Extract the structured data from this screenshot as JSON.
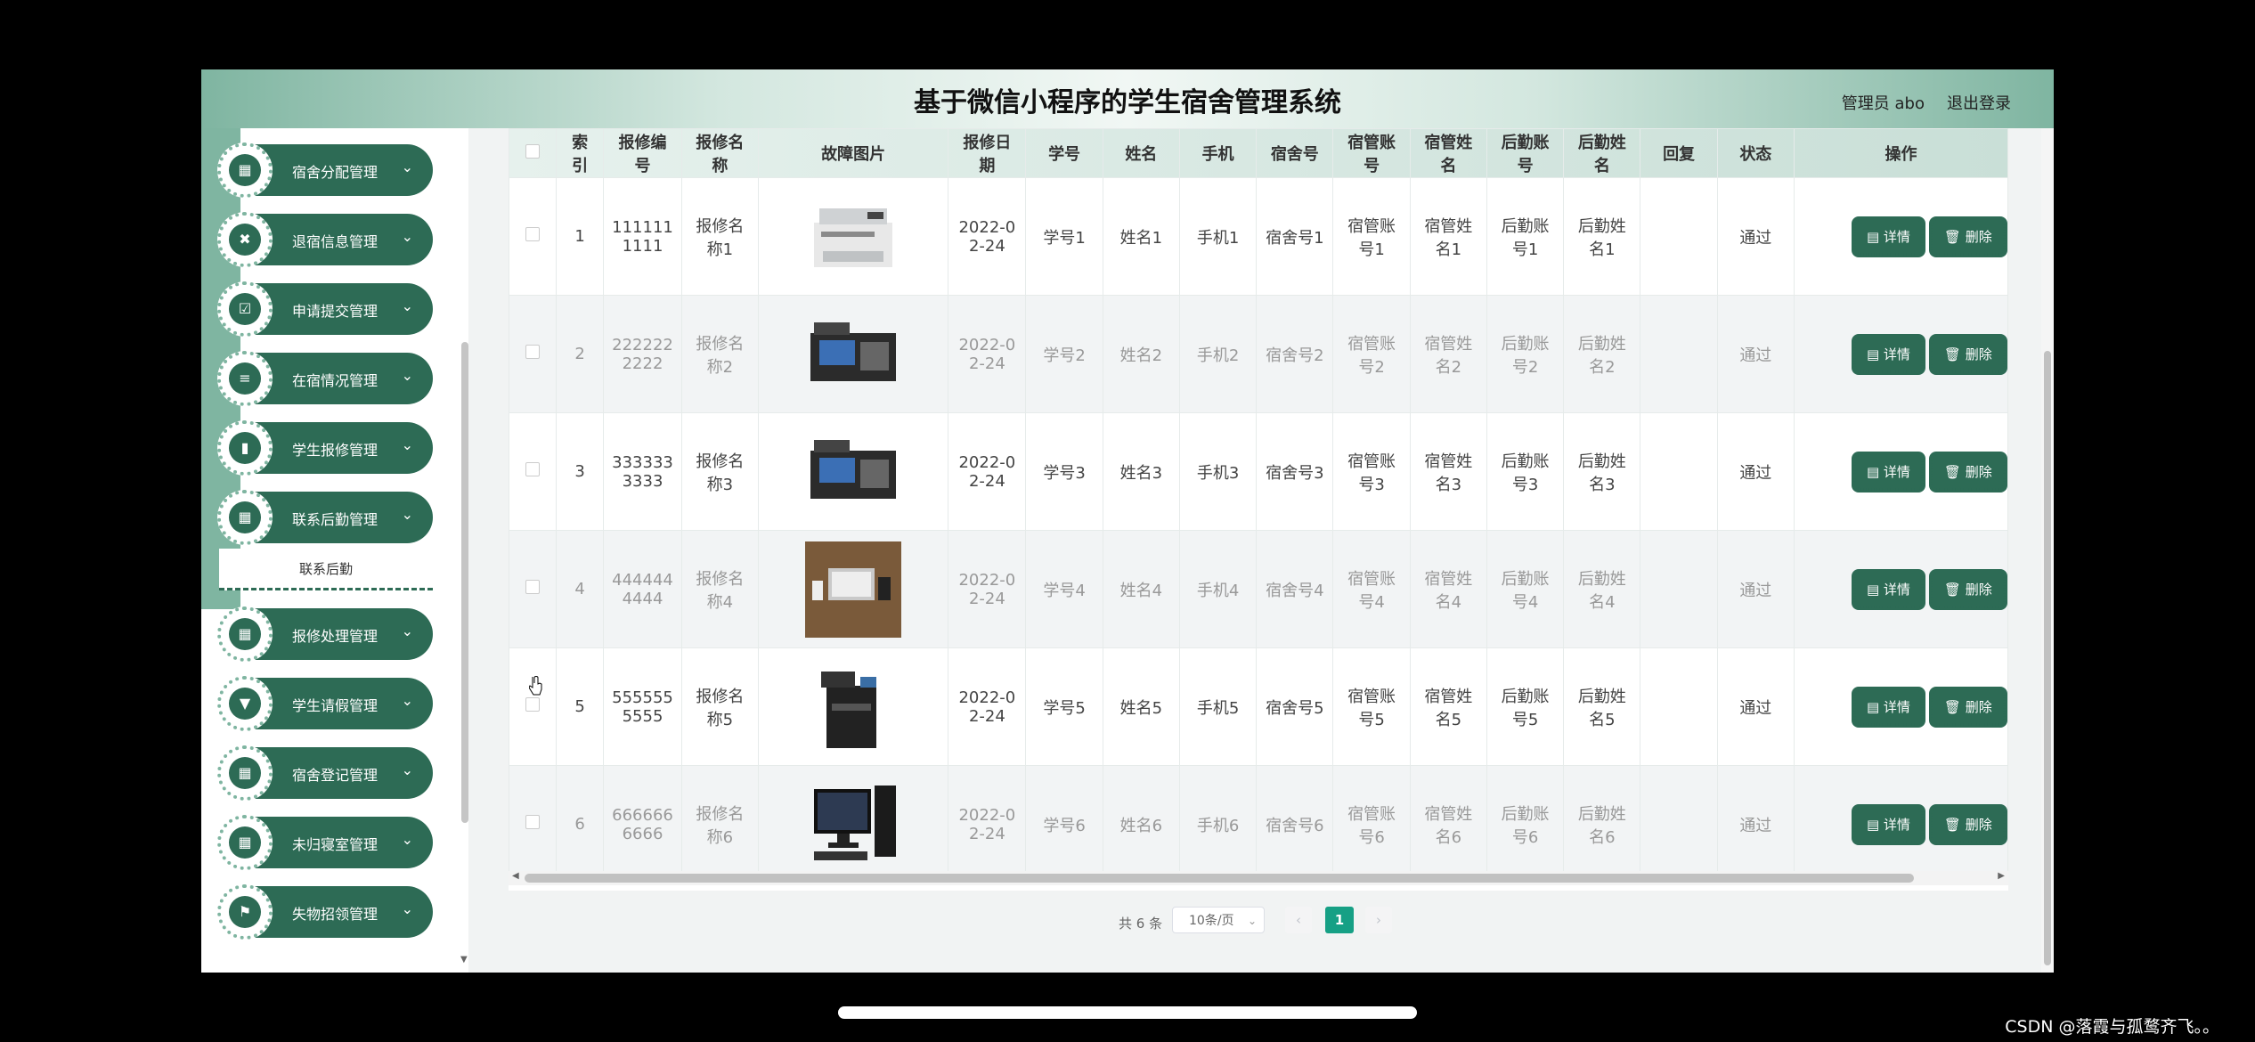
{
  "header": {
    "title": "基于微信小程序的学生宿舍管理系统",
    "user": "管理员 abo",
    "logout": "退出登录"
  },
  "sidebar": {
    "items": [
      {
        "label": "宿舍分配管理",
        "icon": "grid-icon"
      },
      {
        "label": "退宿信息管理",
        "icon": "cross-icon"
      },
      {
        "label": "申请提交管理",
        "icon": "check-icon"
      },
      {
        "label": "在宿情况管理",
        "icon": "list-icon"
      },
      {
        "label": "学生报修管理",
        "icon": "bar-chart-icon"
      },
      {
        "label": "联系后勤管理",
        "icon": "grid-icon"
      },
      {
        "label": "报修处理管理",
        "icon": "grid-icon"
      },
      {
        "label": "学生请假管理",
        "icon": "funnel-icon"
      },
      {
        "label": "宿舍登记管理",
        "icon": "grid-icon"
      },
      {
        "label": "未归寝室管理",
        "icon": "grid-icon"
      },
      {
        "label": "失物招领管理",
        "icon": "flag-icon"
      }
    ],
    "submenu": "联系后勤"
  },
  "table": {
    "columns": [
      "",
      "索\n引",
      "报修编\n号",
      "报修名\n称",
      "故障图片",
      "报修日\n期",
      "学号",
      "姓名",
      "手机",
      "宿舍号",
      "宿管账\n号",
      "宿管姓\n名",
      "后勤账\n号",
      "后勤姓\n名",
      "回复",
      "状态",
      "操作"
    ],
    "rows": [
      {
        "index": "1",
        "code": "111111\n1111",
        "name": "报修名\n称1",
        "img": "copier",
        "date": "2022-0\n2-24",
        "sno": "学号1",
        "sname": "姓名1",
        "phone": "手机1",
        "dorm": "宿舍号1",
        "mgr_acc": "宿管账\n号1",
        "mgr_name": "宿管姓\n名1",
        "log_acc": "后勤账\n号1",
        "log_name": "后勤姓\n名1",
        "reply": "",
        "status": "通过"
      },
      {
        "index": "2",
        "code": "222222\n2222",
        "name": "报修名\n称2",
        "img": "pos",
        "date": "2022-0\n2-24",
        "sno": "学号2",
        "sname": "姓名2",
        "phone": "手机2",
        "dorm": "宿舍号2",
        "mgr_acc": "宿管账\n号2",
        "mgr_name": "宿管姓\n名2",
        "log_acc": "后勤账\n号2",
        "log_name": "后勤姓\n名2",
        "reply": "",
        "status": "通过"
      },
      {
        "index": "3",
        "code": "333333\n3333",
        "name": "报修名\n称3",
        "img": "pos",
        "date": "2022-0\n2-24",
        "sno": "学号3",
        "sname": "姓名3",
        "phone": "手机3",
        "dorm": "宿舍号3",
        "mgr_acc": "宿管账\n号3",
        "mgr_name": "宿管姓\n名3",
        "log_acc": "后勤账\n号3",
        "log_name": "后勤姓\n名3",
        "reply": "",
        "status": "通过"
      },
      {
        "index": "4",
        "code": "444444\n4444",
        "name": "报修名\n称4",
        "img": "desk",
        "date": "2022-0\n2-24",
        "sno": "学号4",
        "sname": "姓名4",
        "phone": "手机4",
        "dorm": "宿舍号4",
        "mgr_acc": "宿管账\n号4",
        "mgr_name": "宿管姓\n名4",
        "log_acc": "后勤账\n号4",
        "log_name": "后勤姓\n名4",
        "reply": "",
        "status": "通过"
      },
      {
        "index": "5",
        "code": "555555\n5555",
        "name": "报修名\n称5",
        "img": "printer",
        "date": "2022-0\n2-24",
        "sno": "学号5",
        "sname": "姓名5",
        "phone": "手机5",
        "dorm": "宿舍号5",
        "mgr_acc": "宿管账\n号5",
        "mgr_name": "宿管姓\n名5",
        "log_acc": "后勤账\n号5",
        "log_name": "后勤姓\n名5",
        "reply": "",
        "status": "通过"
      },
      {
        "index": "6",
        "code": "666666\n6666",
        "name": "报修名\n称6",
        "img": "computer",
        "date": "2022-0\n2-24",
        "sno": "学号6",
        "sname": "姓名6",
        "phone": "手机6",
        "dorm": "宿舍号6",
        "mgr_acc": "宿管账\n号6",
        "mgr_name": "宿管姓\n名6",
        "log_acc": "后勤账\n号6",
        "log_name": "后勤姓\n名6",
        "reply": "",
        "status": "通过"
      }
    ],
    "detail_label": "详情",
    "delete_label": "删除"
  },
  "pager": {
    "total": "共 6 条",
    "page_size": "10条/页",
    "current_page": "1"
  },
  "watermark": "CSDN @落霞与孤鹜齐飞。。"
}
